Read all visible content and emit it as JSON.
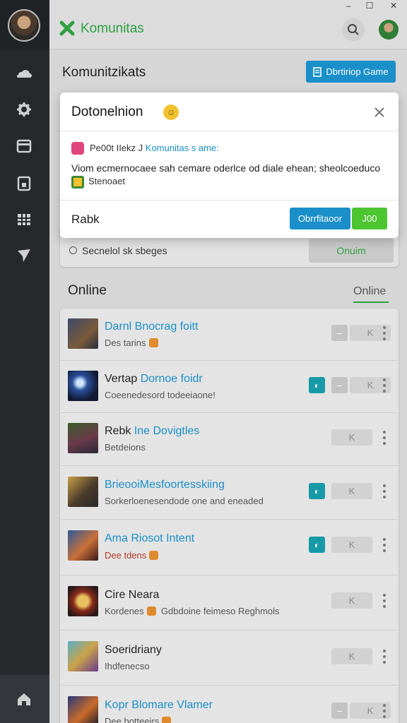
{
  "app": {
    "brand_name": "Komunitas",
    "brand_color": "#2ea043",
    "window_controls": [
      "–",
      "☐",
      "✕"
    ]
  },
  "sidebar": {
    "items": [
      {
        "icon": "cloud-icon"
      },
      {
        "icon": "gear-icon"
      },
      {
        "icon": "store-icon"
      },
      {
        "icon": "inventory-icon"
      },
      {
        "icon": "calendar-grid-icon"
      },
      {
        "icon": "send-icon"
      }
    ],
    "bottom_icon": "home-icon"
  },
  "header": {
    "title": "Komunitzikats",
    "action_label": "Dbrtiriop Game"
  },
  "modal": {
    "title": "Dotonelnion",
    "emoji_icon": "smiley-icon",
    "from_label": "Pe00t IIekz J",
    "from_link": "Komunitas s ame:",
    "body": "Viom ecmernocaee sah cemare oderlce od diale ehean; sheolcoeduco",
    "badge_label": "Stenoaet",
    "footer_label": "Rabk",
    "primary_button": "Obrrfitaoor",
    "ok_button": "J00"
  },
  "background_card": {
    "radio_label": "Secnelol sk sbeges",
    "button_label": "Onuim"
  },
  "online": {
    "title": "Online",
    "tab_label": "Online",
    "rows": [
      {
        "title": "Darnl Bnocrag foitt",
        "title_plain": "",
        "subtitle": "Des tarins",
        "coin": true,
        "teal": false,
        "minus": true,
        "k_label": "K"
      },
      {
        "title": "Dornoe foidr",
        "title_plain": "Vertap ",
        "subtitle": "Coeenedesord todeeiaone!",
        "coin": false,
        "teal": true,
        "minus": true,
        "k_label": "K"
      },
      {
        "title": "Ine Dovigtles",
        "title_plain": "Rebk ",
        "subtitle": "Betdeions",
        "coin": false,
        "teal": false,
        "minus": false,
        "k_label": "K"
      },
      {
        "title": "BrieooiMesfoortesskiing",
        "title_plain": "",
        "subtitle": "Sorkerloenesendode one and eneaded",
        "coin": false,
        "teal": true,
        "minus": false,
        "k_label": "K"
      },
      {
        "title": "Ama Riosot Intent",
        "title_plain": "",
        "subtitle": "Dee tdens",
        "coin": true,
        "teal": true,
        "minus": false,
        "k_label": "K"
      },
      {
        "title": "",
        "title_plain": "Cire Neara",
        "subtitle": "Kordenes",
        "subtitle_extra": "Gdbdoine feimeso Reghmols",
        "coin": true,
        "teal": false,
        "minus": false,
        "k_label": "K"
      },
      {
        "title": "",
        "title_plain": "Soeridriany",
        "subtitle": "Ihdfenecso",
        "coin": false,
        "teal": false,
        "minus": false,
        "k_label": "K"
      },
      {
        "title": "Kopr Blomare Vlamer",
        "title_plain": "",
        "subtitle": "Dee botteeirs",
        "coin": true,
        "teal": false,
        "minus": true,
        "k_label": "K"
      }
    ]
  },
  "colors": {
    "accent_blue": "#1a8fc9",
    "accent_green": "#4cc531",
    "teal": "#179aa8",
    "sidebar": "#26292c"
  }
}
